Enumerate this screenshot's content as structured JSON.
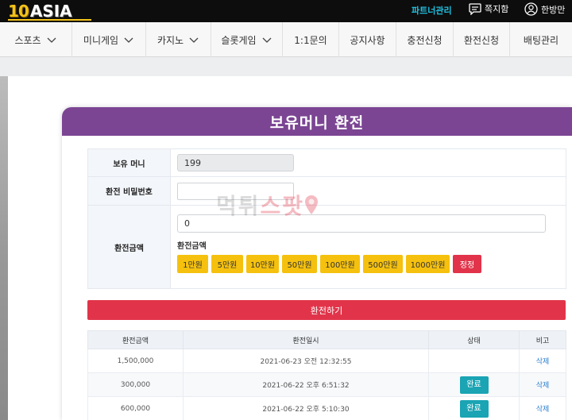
{
  "header": {
    "logo_num": "10",
    "logo_text": "ASIA",
    "partner_label": "파트너관리",
    "message_label": "쪽지함",
    "user_label": "한방만"
  },
  "nav": {
    "items": [
      {
        "label": "스포츠",
        "dropdown": true
      },
      {
        "label": "미니게임",
        "dropdown": true
      },
      {
        "label": "카지노",
        "dropdown": true
      },
      {
        "label": "슬롯게임",
        "dropdown": true
      },
      {
        "label": "1:1문의",
        "dropdown": false
      },
      {
        "label": "공지사항",
        "dropdown": false
      },
      {
        "label": "충전신청",
        "dropdown": false
      },
      {
        "label": "환전신청",
        "dropdown": false
      },
      {
        "label": "배팅관리",
        "dropdown": false
      }
    ]
  },
  "panel": {
    "title": "보유머니 환전",
    "money_label": "보유 머니",
    "money_value": "199",
    "password_label": "환전 비밀번호",
    "password_value": "",
    "amount_label": "환전금액",
    "amount_value": "0",
    "amount_sub_label": "환전금액",
    "amount_buttons": [
      "1만원",
      "5만원",
      "10만원",
      "50만원",
      "100만원",
      "500만원",
      "1000만원"
    ],
    "reset_label": "정정",
    "submit_label": "환전하기"
  },
  "history": {
    "columns": [
      "환전금액",
      "환전일시",
      "상태",
      "비고"
    ],
    "rows": [
      {
        "amount": "1,500,000",
        "datetime": "2021-06-23 오전 12:32:55",
        "status": "",
        "note": "삭제"
      },
      {
        "amount": "300,000",
        "datetime": "2021-06-22 오후 6:51:32",
        "status": "완료",
        "note": "삭제"
      },
      {
        "amount": "600,000",
        "datetime": "2021-06-22 오후 5:10:30",
        "status": "완료",
        "note": "삭제"
      }
    ]
  },
  "watermark": {
    "text_a": "먹튀",
    "text_b": "스팟"
  },
  "colors": {
    "accent_purple": "#7b4593",
    "yellow": "#f5c10e",
    "red": "#e1344a",
    "teal": "#1aa4b4",
    "partner_cyan": "#20c0e0"
  }
}
